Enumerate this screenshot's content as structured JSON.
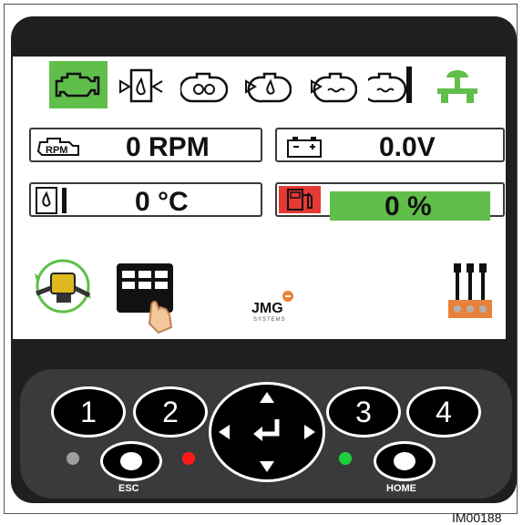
{
  "status": {
    "rpm_value": "0 RPM",
    "voltage_value": "0.0V",
    "temperature_value": "0 °C",
    "fuel_value": "0 %",
    "fuel_level_percent": 0
  },
  "icons": {
    "top_row": [
      "engine-icon",
      "fuel-filter-icon",
      "air-filter-icon",
      "oil-pressure-icon",
      "coolant-level-icon",
      "coolant-temp-icon",
      "valve-icon"
    ],
    "tiles": [
      "rpm-icon",
      "battery-icon",
      "tank-temp-icon",
      "fuel-pump-icon"
    ],
    "bottom": [
      "rotation-machine-icon",
      "touch-menu-icon",
      "lever-control-icon"
    ]
  },
  "brand": {
    "logo_text": "JMG",
    "logo_sub": "SYSTEMS"
  },
  "keypad": {
    "key1": "1",
    "key2": "2",
    "key3": "3",
    "key4": "4",
    "esc_label": "ESC",
    "home_label": "HOME"
  },
  "colors": {
    "active_green": "#5fbf4a",
    "alert_red": "#e53935",
    "led_gray": "#9e9e9e",
    "led_red": "#ff1a1a",
    "led_green": "#1fcf3a",
    "lever_orange": "#e8823a"
  },
  "reference": "IM00188"
}
